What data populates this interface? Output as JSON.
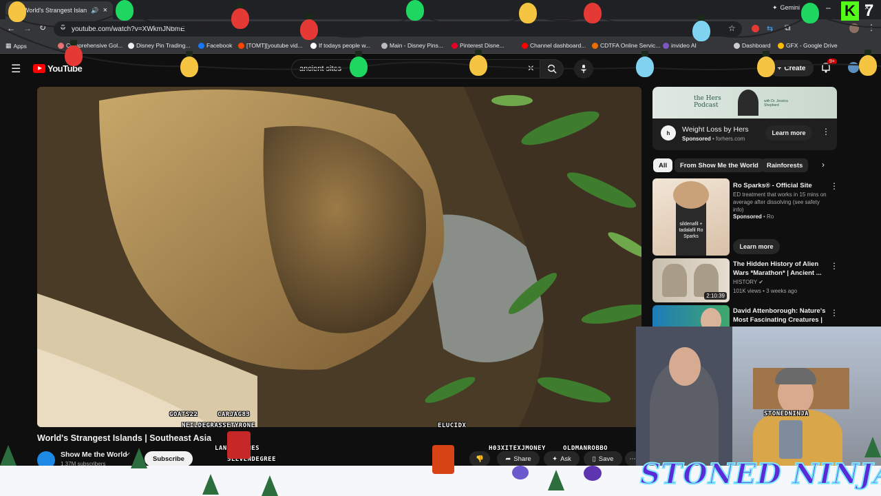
{
  "browser": {
    "tab_title": "World's Strangest Islan",
    "url": "youtube.com/watch?v=XWkmJNbmE",
    "gemini_label": "Gemini",
    "bookmarks": [
      "Apps",
      "Comprehensive Gol...",
      "Disney Pin Trading...",
      "Facebook",
      "[TOMT][youtube vid...",
      "If todays people w...",
      "Main - Disney Pins...",
      "Pinterest Disne...",
      "Channel dashboard...",
      "CDTFA Online Servic...",
      "invideo AI",
      "Dashboard",
      "GFX - Google Drive"
    ]
  },
  "youtube": {
    "logo_text": "YouTube",
    "search_value": "ancient sites",
    "create_label": "Create",
    "notif_count": "9+"
  },
  "video": {
    "title": "World's Strangest Islands | Southeast Asia",
    "channel": "Show Me the World",
    "subscribers": "1.37M subscribers",
    "subscribe_label": "Subscribe",
    "share_label": "Share",
    "ask_label": "Ask",
    "save_label": "Save"
  },
  "sidebar": {
    "ad": {
      "banner_title": "the Hers Podcast",
      "banner_sub": "with Dr. Jessica Shepherd",
      "title": "Weight Loss by Hers",
      "sponsored": "Sponsored",
      "domain": "forhers.com",
      "learn_more": "Learn more"
    },
    "chips": [
      "All",
      "From Show Me the World",
      "Rainforests"
    ],
    "recs": [
      {
        "title": "Ro Sparks® - Official Site",
        "desc": "ED treatment that works in 15 mins on average after dissolving (see safety info)",
        "meta1": "Sponsored",
        "meta2": "Ro",
        "thumb_text": "sildenafil + tadalafil Ro Sparks",
        "learn_more": "Learn more"
      },
      {
        "title": "The Hidden History of Alien Wars *Marathon* | Ancient ...",
        "channel": "HISTORY",
        "meta": "101K views • 3 weeks ago",
        "duration": "2:10:39"
      },
      {
        "title": "David Attenborough: Nature's Most Fascinating Creatures | ..."
      }
    ]
  },
  "overlay": {
    "nicknames": [
      "GOATS22",
      "CARJAG83",
      "NEILDEGRASSETYRONE",
      "LANGINGAMES",
      "SLEVENDEGREE",
      "ELUCIDX",
      "H03XITEXJMONEY",
      "OLDMANROBBO",
      "STONEDNINJA"
    ],
    "brand": "STONED NINJA",
    "k_logo": "K",
    "k_count": "7"
  },
  "colors": {
    "bg": "#0f0f0f",
    "accent_red": "#ff0000",
    "brand_purple": "#5b2bd8"
  }
}
